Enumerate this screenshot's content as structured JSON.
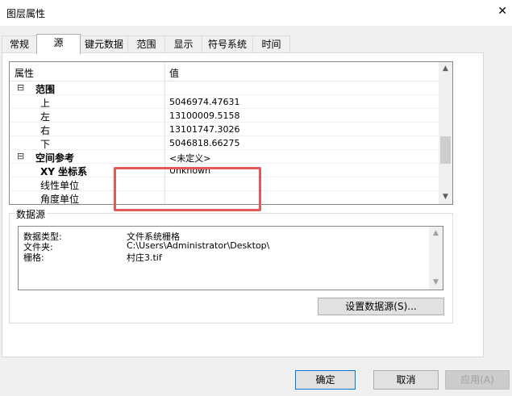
{
  "window": {
    "title": "图层属性",
    "close_glyph": "✕"
  },
  "tabs": [
    {
      "label": "常规",
      "active": false
    },
    {
      "label": "源",
      "active": true
    },
    {
      "label": "键元数据",
      "active": false
    },
    {
      "label": "范围",
      "active": false
    },
    {
      "label": "显示",
      "active": false
    },
    {
      "label": "符号系统",
      "active": false
    },
    {
      "label": "时间",
      "active": false
    }
  ],
  "grid": {
    "header": {
      "property": "属性",
      "value": "值"
    },
    "expander_glyph": "⊟",
    "rows": [
      {
        "key": "范围",
        "value": "",
        "bold": true,
        "category": true
      },
      {
        "key": "上",
        "value": "5046974.47631",
        "bold": false,
        "category": false
      },
      {
        "key": "左",
        "value": "13100009.5158",
        "bold": false,
        "category": false
      },
      {
        "key": "右",
        "value": "13101747.3026",
        "bold": false,
        "category": false
      },
      {
        "key": "下",
        "value": "5046818.66275",
        "bold": false,
        "category": false
      },
      {
        "key": "空间参考",
        "value": "<未定义>",
        "bold": true,
        "category": true
      },
      {
        "key": "XY 坐标系",
        "value": "Unknown",
        "bold": true,
        "category": false
      },
      {
        "key": "线性单位",
        "value": "",
        "bold": false,
        "category": false
      },
      {
        "key": "角度单位",
        "value": "",
        "bold": false,
        "category": false
      }
    ],
    "scroll_up_glyph": "▲",
    "scroll_down_glyph": "▼"
  },
  "datasource": {
    "group_label": "数据源",
    "rows": [
      {
        "label": "数据类型:",
        "value": "文件系统栅格"
      },
      {
        "label": "文件夹:",
        "value": "C:\\Users\\Administrator\\Desktop\\"
      },
      {
        "label": "栅格:",
        "value": "村庄3.tif"
      }
    ],
    "set_button_label": "设置数据源(S)..."
  },
  "buttons": {
    "ok": "确定",
    "cancel": "取消",
    "apply": "应用(A)"
  },
  "colors": {
    "highlight_border": "#e05a5a",
    "primary_border": "#0078d7"
  }
}
